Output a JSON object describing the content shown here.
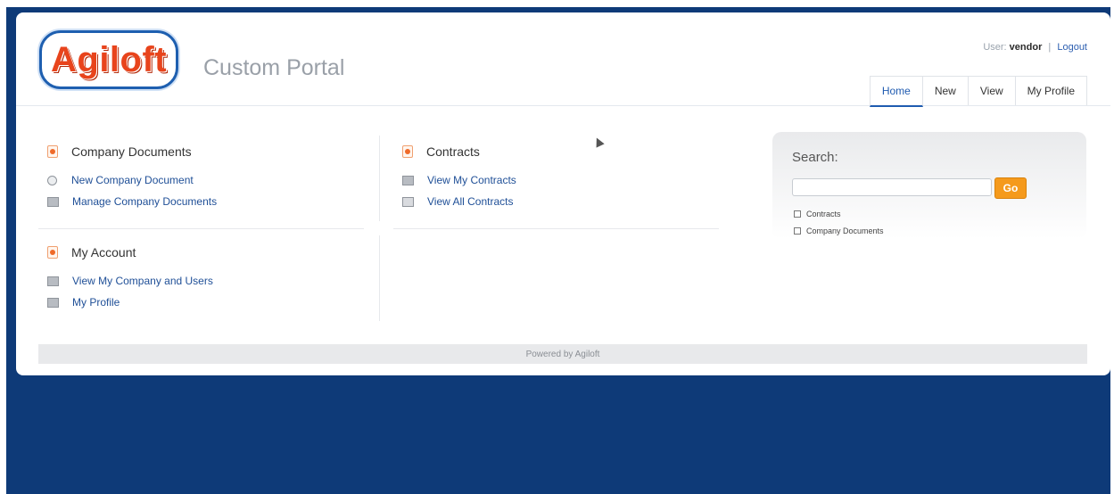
{
  "header": {
    "logo_text": "Agiloft",
    "portal_name": "Custom Portal",
    "user_label": "User:",
    "user_name": "vendor",
    "separator": "|",
    "logout": "Logout"
  },
  "tabs": [
    {
      "label": "Home",
      "active": true
    },
    {
      "label": "New"
    },
    {
      "label": "View"
    },
    {
      "label": "My Profile"
    }
  ],
  "sections": {
    "company_documents": {
      "title": "Company Documents",
      "links": [
        "New Company Document",
        "Manage Company Documents"
      ]
    },
    "contracts": {
      "title": "Contracts",
      "links": [
        "View My Contracts",
        "View All Contracts"
      ]
    },
    "my_account": {
      "title": "My Account",
      "links": [
        "View My Company and Users",
        "My Profile"
      ]
    }
  },
  "search": {
    "label": "Search:",
    "button": "Go",
    "options": [
      "Contracts",
      "Company Documents"
    ]
  },
  "footer": {
    "text": "Powered by Agiloft"
  },
  "colors": {
    "background": "#0e3a78",
    "link": "#1f4f97",
    "accent": "#f59a1c",
    "logo": "#e8441c"
  }
}
